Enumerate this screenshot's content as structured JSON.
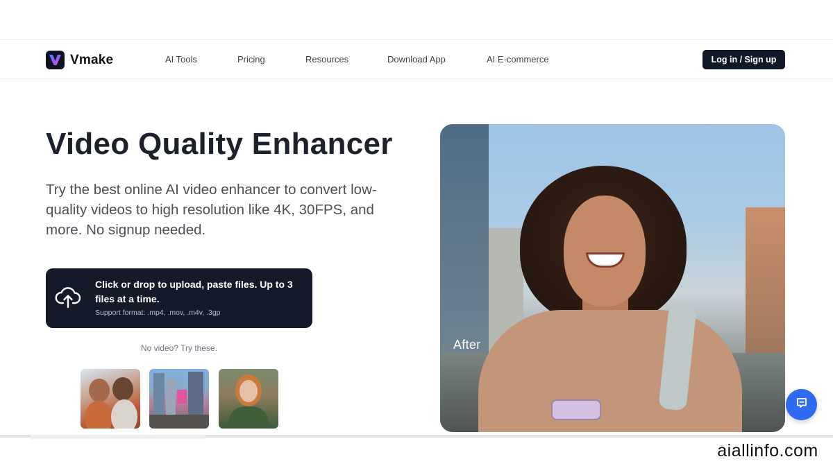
{
  "brand": {
    "name": "Vmake"
  },
  "nav": {
    "items": [
      {
        "label": "AI Tools"
      },
      {
        "label": "Pricing"
      },
      {
        "label": "Resources"
      },
      {
        "label": "Download App"
      },
      {
        "label": "AI E-commerce"
      }
    ],
    "login_label": "Log in / Sign up"
  },
  "hero": {
    "title": "Video Quality Enhancer",
    "subtitle": "Try the best online AI video enhancer to convert low-quality videos to high resolution like 4K, 30FPS, and more. No signup needed.",
    "image_label": "After"
  },
  "upload": {
    "main_text": "Click or drop to upload, paste files. Up to 3 files at a time.",
    "formats_text": "Support format: .mp4, .mov, .m4v, .3gp",
    "icon": "upload-cloud-icon"
  },
  "samples": {
    "label": "No video? Try these."
  },
  "chat": {
    "icon": "chat-icon"
  },
  "watermark": "aiallinfo.com",
  "colors": {
    "accent_dark": "#141a29",
    "chat_blue": "#2f6bf1",
    "logo_violet": "#7c5cff"
  }
}
